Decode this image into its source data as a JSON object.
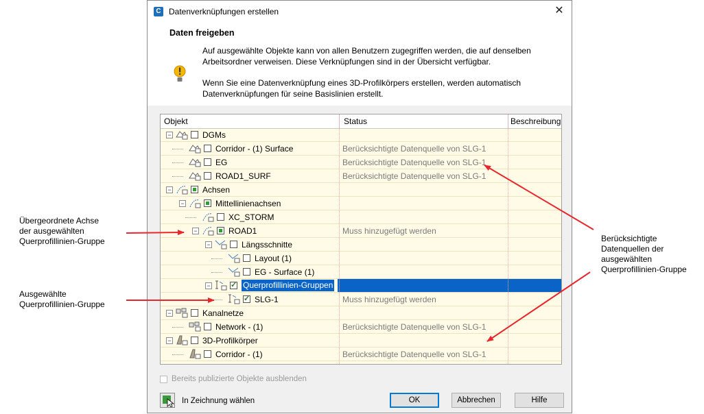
{
  "window": {
    "title": "Datenverknüpfungen erstellen",
    "close_glyph": "✕",
    "app_icon": "C"
  },
  "header": {
    "title": "Daten freigeben",
    "para1": [
      "Auf ausgewählte Objekte kann von allen Benutzern zugegriffen werden, die auf denselben",
      "Arbeitsordner verweisen. Diese Verknüpfungen sind in der Übersicht verfügbar."
    ],
    "para2": [
      "Wenn Sie eine Datenverknüpfung eines 3D-Profilkörpers erstellen, werden automatisch",
      "Datenverknüpfungen für seine Basislinien erstellt."
    ]
  },
  "columns": [
    "Objekt",
    "Status",
    "Beschreibung"
  ],
  "rows": [
    {
      "label": "DGMs",
      "status": "",
      "check": "none",
      "expander": "−",
      "icon": "surface-icon"
    },
    {
      "label": "Corridor - (1) Surface",
      "status": "Berücksichtigte Datenquelle von SLG-1",
      "check": "none",
      "icon": "surface-icon"
    },
    {
      "label": "EG",
      "status": "Berücksichtigte Datenquelle von SLG-1",
      "check": "none",
      "icon": "surface-icon"
    },
    {
      "label": "ROAD1_SURF",
      "status": "Berücksichtigte Datenquelle von SLG-1",
      "check": "none",
      "icon": "surface-icon"
    },
    {
      "label": "Achsen",
      "status": "",
      "check": "partial",
      "expander": "−",
      "icon": "alignment-icon"
    },
    {
      "label": "Mittellinienachsen",
      "status": "",
      "check": "partial",
      "expander": "−",
      "icon": "alignment-icon"
    },
    {
      "label": "XC_STORM",
      "status": "",
      "check": "none",
      "icon": "alignment-icon"
    },
    {
      "label": "ROAD1",
      "status": "Muss hinzugefügt werden",
      "check": "partial",
      "expander": "−",
      "icon": "alignment-icon"
    },
    {
      "label": "Längsschnitte",
      "status": "",
      "check": "none",
      "expander": "−",
      "icon": "profile-icon"
    },
    {
      "label": "Layout (1)",
      "status": "",
      "check": "none",
      "icon": "profile-icon"
    },
    {
      "label": "EG - Surface (1)",
      "status": "",
      "check": "none",
      "icon": "profile-icon"
    },
    {
      "label": "Querprofillinien-Gruppen",
      "status": "",
      "check": "checked",
      "expander": "−",
      "icon": "sample-line-icon",
      "selected": true
    },
    {
      "label": "SLG-1",
      "status": "Muss hinzugefügt werden",
      "check": "checked",
      "icon": "sample-line-icon"
    },
    {
      "label": "Kanalnetze",
      "status": "",
      "check": "none",
      "expander": "−",
      "icon": "pipe-network-icon"
    },
    {
      "label": "Network - (1)",
      "status": "Berücksichtigte Datenquelle von SLG-1",
      "check": "none",
      "icon": "pipe-network-icon"
    },
    {
      "label": "3D-Profilkörper",
      "status": "",
      "check": "none",
      "expander": "−",
      "icon": "corridor-icon"
    },
    {
      "label": "Corridor - (1)",
      "status": "Berücksichtigte Datenquelle von SLG-1",
      "check": "none",
      "icon": "corridor-icon"
    }
  ],
  "footer": {
    "hide_published": "Bereits publizierte Objekte ausblenden",
    "pick_in_drawing": "In Zeichnung wählen",
    "ok": "OK",
    "cancel": "Abbrechen",
    "help": "Hilfe"
  },
  "annotations": {
    "parent_alignment": [
      "Übergeordnete Achse",
      "der ausgewählten",
      "Querprofillinien-Gruppe"
    ],
    "selected_group": [
      "Ausgewählte",
      "Querprofillinien-Gruppe"
    ],
    "data_sources": [
      "Berücksichtigte",
      "Datenquellen der",
      "ausgewählten",
      "Querprofillinien-Gruppe"
    ]
  },
  "colors": {
    "arrow": "#e8262b",
    "selection": "#0a64c8",
    "tree_bg": "#fffbe6"
  }
}
